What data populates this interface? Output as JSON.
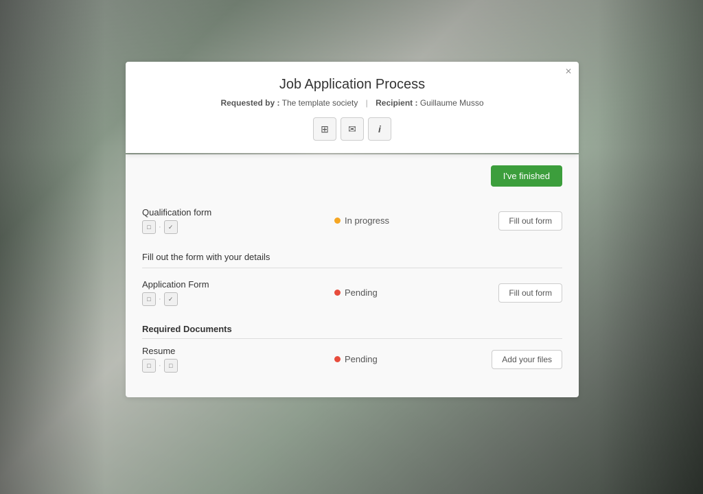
{
  "background": {
    "description": "Office interior background"
  },
  "modal": {
    "close_label": "✕",
    "header": {
      "title": "Job Application Process",
      "requested_by_label": "Requested by :",
      "requested_by_value": "The template society",
      "separator": "|",
      "recipient_label": "Recipient :",
      "recipient_value": "Guillaume Musso",
      "icon_buttons": [
        {
          "name": "grid-icon",
          "symbol": "⊞"
        },
        {
          "name": "mail-icon",
          "symbol": "✉"
        },
        {
          "name": "info-icon",
          "symbol": "i"
        }
      ]
    },
    "body": {
      "finished_button_label": "I've finished",
      "sections": [
        {
          "name": "qualification-form-section",
          "items": [
            {
              "name": "qualification-form-item",
              "label": "Qualification form",
              "icons": [
                "□",
                "✓"
              ],
              "status_dot": "yellow",
              "status_label": "In progress",
              "action_label": "Fill out form"
            }
          ],
          "description": "Fill out the form with your details"
        },
        {
          "name": "application-form-section",
          "items": [
            {
              "name": "application-form-item",
              "label": "Application Form",
              "icons": [
                "□",
                "✓"
              ],
              "status_dot": "red",
              "status_label": "Pending",
              "action_label": "Fill out form"
            }
          ]
        },
        {
          "name": "required-documents-section",
          "section_title": "Required Documents",
          "items": [
            {
              "name": "resume-item",
              "label": "Resume",
              "icons": [
                "□",
                "□"
              ],
              "status_dot": "red",
              "status_label": "Pending",
              "action_label": "Add your files"
            }
          ]
        }
      ]
    }
  }
}
